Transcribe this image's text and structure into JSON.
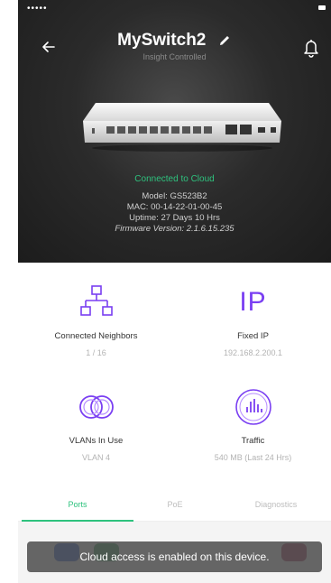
{
  "header": {
    "title": "MySwitch2",
    "subtitle": "Insight Controlled"
  },
  "device_info": {
    "cloud_status": "Connected to Cloud",
    "model": "Model: GS523B2",
    "mac": "MAC: 00-14-22-01-00-45",
    "uptime": "Uptime: 27 Days 10 Hrs",
    "firmware": "Firmware Version: 2.1.6.15.235"
  },
  "tiles": [
    {
      "label": "Connected Neighbors",
      "value": "1 / 16",
      "icon": "network-icon"
    },
    {
      "label": "Fixed IP",
      "value": "192.168.2.200.1",
      "icon": "ip-icon"
    },
    {
      "label": "VLANs In Use",
      "value": "VLAN 4",
      "icon": "vlan-icon"
    },
    {
      "label": "Traffic",
      "value": "540 MB (Last 24 Hrs)",
      "icon": "traffic-icon"
    }
  ],
  "tiles_icon_text": {
    "ip": "IP"
  },
  "tabs": [
    {
      "label": "Ports",
      "active": true
    },
    {
      "label": "PoE",
      "active": false
    },
    {
      "label": "Diagnostics",
      "active": false
    }
  ],
  "toast": {
    "message": "Cloud access is enabled on this device."
  },
  "colors": {
    "accent_green": "#2ec27e",
    "accent_purple": "#7a3ff2",
    "hero_dark": "#1c1c1c"
  }
}
